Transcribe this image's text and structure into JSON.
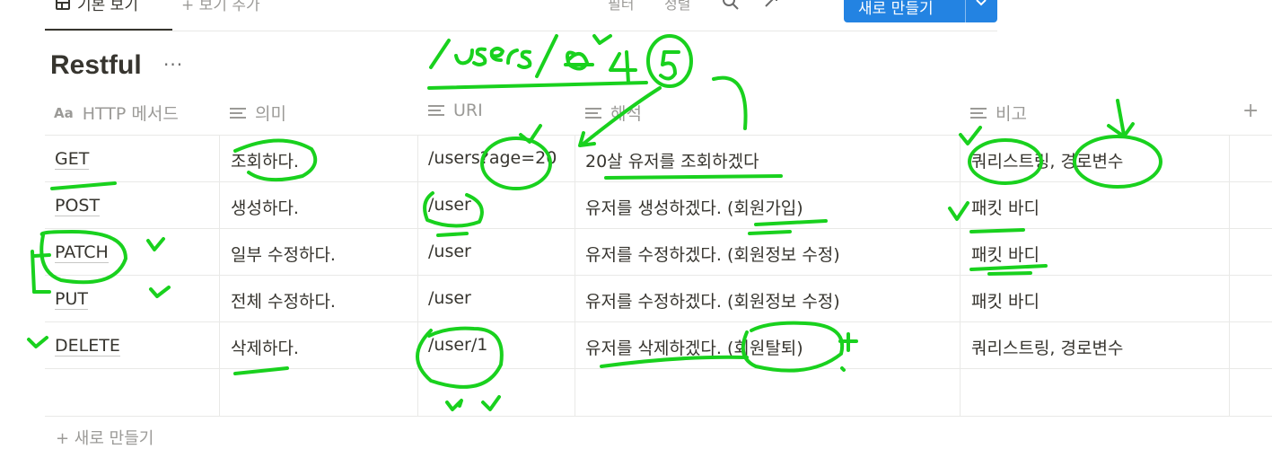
{
  "toolbar": {
    "view_tab_label": "기본 보기",
    "add_view_label": "보기 추가",
    "filter_label": "필터",
    "sort_label": "정렬",
    "new_button_label": "새로 만들기",
    "icons": [
      "table-icon",
      "plus-icon",
      "search-icon",
      "expand-icon",
      "more-icon",
      "chevron-down-icon"
    ]
  },
  "database": {
    "title": "Restful",
    "more": "···"
  },
  "table": {
    "columns": [
      {
        "label": "HTTP 메서드",
        "icon": "aa-icon"
      },
      {
        "label": "의미",
        "icon": "text-lines-icon"
      },
      {
        "label": "URI",
        "icon": "text-lines-icon"
      },
      {
        "label": "해석",
        "icon": "text-lines-icon"
      },
      {
        "label": "비고",
        "icon": "text-lines-icon"
      }
    ],
    "add_column": "+",
    "rows": [
      {
        "method": "GET",
        "meaning": "조회하다.",
        "uri": "/users?age=20",
        "interp": "20살 유저를 조회하겠다",
        "note": "쿼리스트링, 경로변수"
      },
      {
        "method": "POST",
        "meaning": "생성하다.",
        "uri": "/user",
        "interp": "유저를 생성하겠다. (회원가입)",
        "note": "패킷 바디"
      },
      {
        "method": "PATCH",
        "meaning": "일부 수정하다.",
        "uri": "/user",
        "interp": "유저를 수정하겠다. (회원정보 수정)",
        "note": "패킷 바디"
      },
      {
        "method": "PUT",
        "meaning": "전체 수정하다.",
        "uri": "/user",
        "interp": "유저를 수정하겠다. (회원정보 수정)",
        "note": "패킷 바디"
      },
      {
        "method": "DELETE",
        "meaning": "삭제하다.",
        "uri": "/user/1",
        "interp": "유저를 삭제하겠다. (회원탈퇴)",
        "note": "쿼리스트링, 경로변수"
      }
    ],
    "new_row_label": "+ 새로 만들기"
  },
  "annotations": {
    "handwriting": [
      "/users / 8 4 5",
      "+"
    ],
    "ink_color": "#19d11e"
  }
}
